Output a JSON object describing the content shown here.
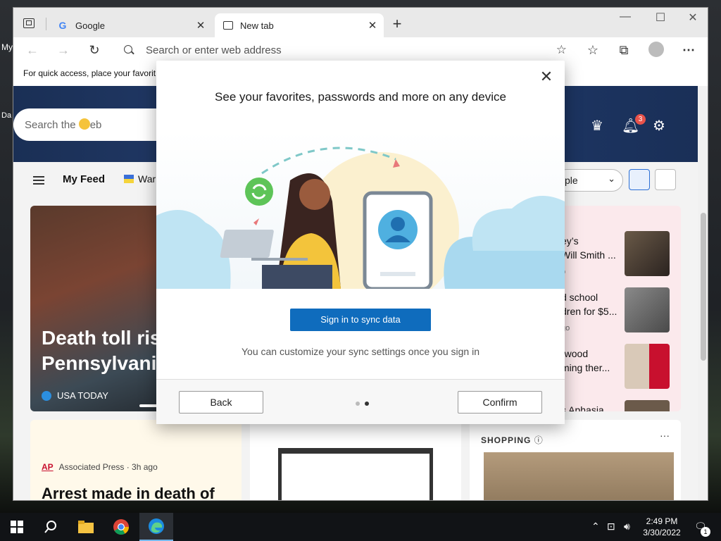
{
  "desktop": {
    "label_1": "My",
    "label_2": "Da"
  },
  "tabs": [
    {
      "label": "Google",
      "icon": "google-g-icon",
      "close": "✕"
    },
    {
      "label": "New tab",
      "icon": "newtab-page-icon",
      "close": "✕"
    }
  ],
  "window_controls": {
    "minimize": "—",
    "maximize": "☐",
    "close": "✕",
    "new_tab": "+"
  },
  "toolbar": {
    "back": "←",
    "forward": "→",
    "refresh": "↻",
    "address_placeholder": "Search or enter web address",
    "add_favorite": "☆",
    "favorites": "☆",
    "collections": "⧉",
    "more": "⋯"
  },
  "favorites_bar": {
    "text": "For quick access, place your favorit"
  },
  "page": {
    "search_placeholder_prefix": "Search the ",
    "search_placeholder_suffix": "eb",
    "notification_count": "3",
    "my_feed": "My Feed",
    "feed_tab": "War",
    "dropdown_value": "ple",
    "hero_story": {
      "title_line1": "Death toll ris",
      "title_line2": "Pennsylvania",
      "source": "USA TODAY"
    },
    "side_stories": [
      {
        "title_line1": "ey’s",
        "title_line2": "Will Smith ...",
        "meta": "o"
      },
      {
        "title_line1": "d school",
        "title_line2": "dren for $5...",
        "meta": "go"
      },
      {
        "title_line1": "rwood",
        "title_line2": "ming ther...",
        "meta": ""
      },
      {
        "title_line1": "s Aphasia",
        "title_line2": "",
        "meta": ""
      }
    ],
    "ap_card": {
      "logo": "AP",
      "source": "Associated Press · 3h ago",
      "title": "Arrest made in death of"
    },
    "shopping": {
      "label": "SHOPPING",
      "info": "ⓘ",
      "more": "···"
    }
  },
  "dialog": {
    "title": "See your favorites, passwords and more on any device",
    "close": "✕",
    "primary_button": "Sign in to sync data",
    "hint": "You can customize your sync settings once you sign in",
    "back_button": "Back",
    "confirm_button": "Confirm",
    "step_current": 2,
    "step_total": 2,
    "colors": {
      "primary": "#0f6cbd",
      "dot_active": "#333333",
      "dot_inactive": "#bbbbbb"
    }
  },
  "taskbar": {
    "apps": [
      "start-icon",
      "search-icon",
      "file-explorer-icon",
      "chrome-icon",
      "edge-icon"
    ],
    "time": "2:49 PM",
    "date": "3/30/2022",
    "notification_count": "1"
  }
}
